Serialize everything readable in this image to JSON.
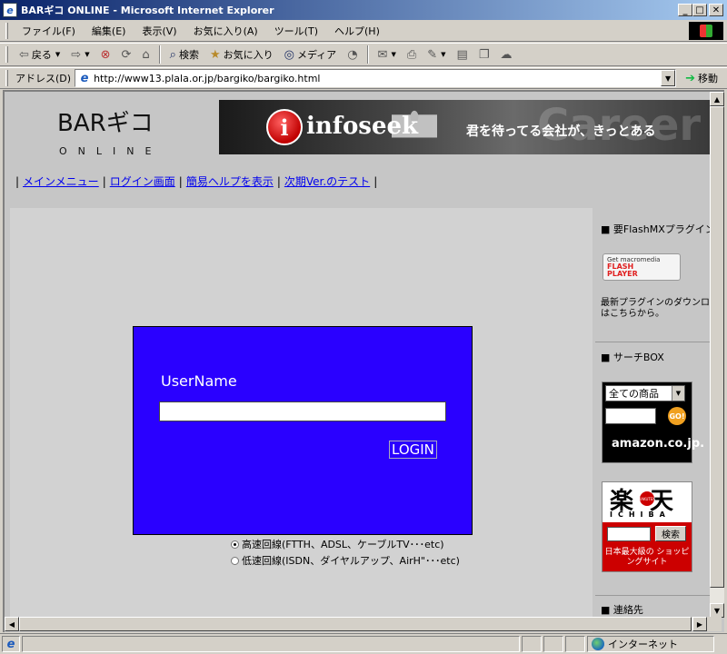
{
  "window": {
    "title": "BARギコ ONLINE - Microsoft Internet Explorer",
    "icon": "ie-icon",
    "buttons": [
      "minimize",
      "maximize",
      "close"
    ]
  },
  "menubar": {
    "items": [
      "ファイル(F)",
      "編集(E)",
      "表示(V)",
      "お気に入り(A)",
      "ツール(T)",
      "ヘルプ(H)"
    ]
  },
  "toolbar": {
    "back_label": "戻る",
    "search_label": "検索",
    "favorites_label": "お気に入り",
    "media_label": "メディア"
  },
  "address": {
    "label": "アドレス(D)",
    "url": "http://www13.plala.or.jp/bargiko/bargiko.html",
    "go_label": "移動"
  },
  "page": {
    "logo_line1": "BARギコ",
    "logo_line2": "ONLINE",
    "banner": {
      "brand": "infoseek",
      "tagline": "君を待ってる会社が、きっとある",
      "watermark": "Career"
    },
    "nav": {
      "links": [
        "メインメニュー",
        "ログイン画面",
        "簡易ヘルプを表示",
        "次期Ver.のテスト"
      ]
    },
    "login": {
      "username_label": "UserName",
      "username_value": "",
      "login_button": "LOGIN",
      "box_color": "#2a00ff"
    },
    "connection": {
      "options": [
        {
          "label": "高速回線(FTTH、ADSL、ケーブルTV･･･etc)",
          "selected": true
        },
        {
          "label": "低速回線(ISDN、ダイヤルアップ、AirH\"･･･etc)",
          "selected": false
        }
      ]
    },
    "sidebar": {
      "flash_heading": "■ 要FlashMXプラグイン",
      "flash_btn_line1": "Get macromedia",
      "flash_btn_line2": "FLASH",
      "flash_btn_line3": "PLAYER",
      "flash_note": "最新プラグインのダウンロードはこちらから。",
      "search_heading": "■ サーチBOX",
      "amazon_select": "全ての商品",
      "amazon_go": "GO!",
      "amazon_brand": "amazon.co.jp.",
      "rakuten_kanji": "楽天",
      "rakuten_dot": "RAKUTEN",
      "rakuten_ichiba": "ICHIBA",
      "rakuten_search": "検索",
      "rakuten_tagline": "日本最大級の ショッピングサイト",
      "contact_heading": "■ 連絡先"
    }
  },
  "statusbar": {
    "zone": "インターネット"
  }
}
